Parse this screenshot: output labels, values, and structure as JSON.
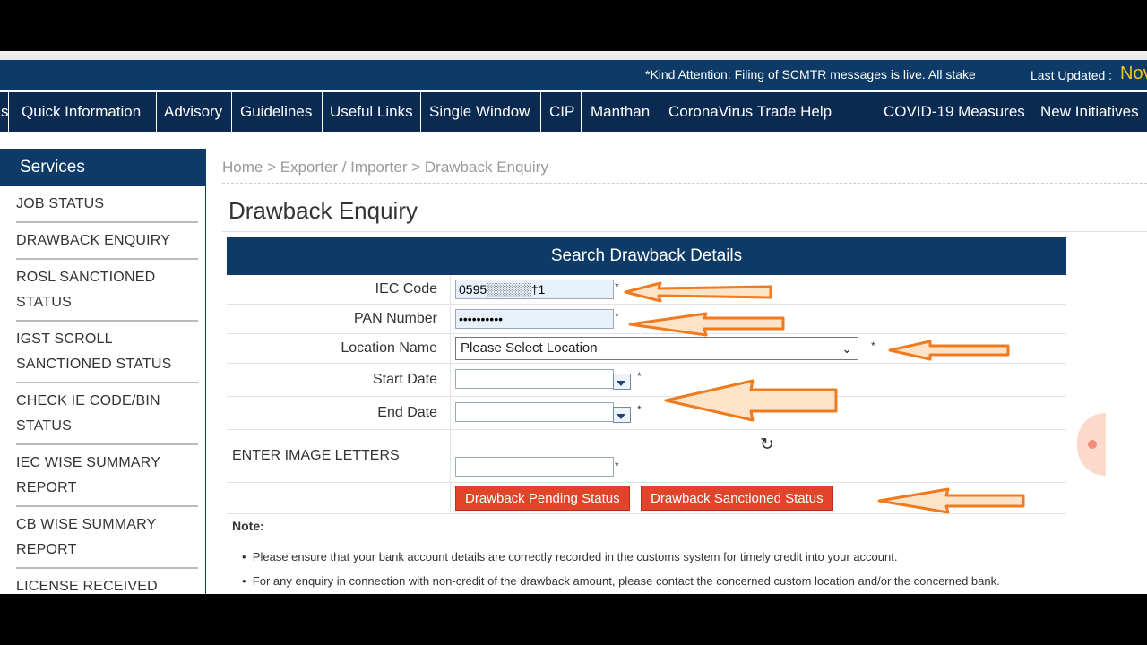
{
  "ticker": {
    "message": "*Kind Attention: Filing of SCMTR messages is live. All stake",
    "last_updated_label": "Last Updated :",
    "last_updated_value": "Nov"
  },
  "nav": {
    "items": [
      "s",
      "Quick Information",
      "Advisory",
      "Guidelines",
      "Useful Links",
      "Single Window",
      "CIP",
      "Manthan",
      "CoronaVirus Trade Help",
      "COVID-19 Measures",
      "New Initiatives"
    ]
  },
  "sidebar": {
    "title": "Services",
    "items": [
      "JOB STATUS",
      "DRAWBACK ENQUIRY",
      "ROSL SANCTIONED STATUS",
      "IGST SCROLL SANCTIONED STATUS",
      "CHECK IE CODE/BIN STATUS",
      "IEC WISE SUMMARY REPORT",
      "CB WISE SUMMARY REPORT",
      "LICENSE RECEIVED FROM DGFT"
    ]
  },
  "breadcrumb": {
    "home": "Home",
    "sep": ">",
    "section": "Exporter / Importer",
    "current": "Drawback Enquiry"
  },
  "page": {
    "title": "Drawback Enquiry"
  },
  "form": {
    "heading": "Search Drawback Details",
    "iec_label": "IEC Code",
    "iec_value": "0595░░░░░†1",
    "pan_label": "PAN Number",
    "pan_value": "••••••••••",
    "location_label": "Location Name",
    "location_value": "Please Select Location",
    "start_label": "Start Date",
    "end_label": "End Date",
    "captcha_label": "ENTER IMAGE LETTERS",
    "required_mark": "*",
    "refresh_icon": "↻",
    "pending_button": "Drawback Pending Status",
    "sanctioned_button": "Drawback Sanctioned Status"
  },
  "notes": {
    "title": "Note:",
    "items": [
      "Please ensure that your bank account details are correctly recorded in the customs system for timely credit into your account.",
      "For any enquiry in connection with non-credit of the drawback amount, please contact the concerned custom location and/or the concerned bank."
    ],
    "bullet": "•"
  },
  "annotation_color": "#f07a1e"
}
